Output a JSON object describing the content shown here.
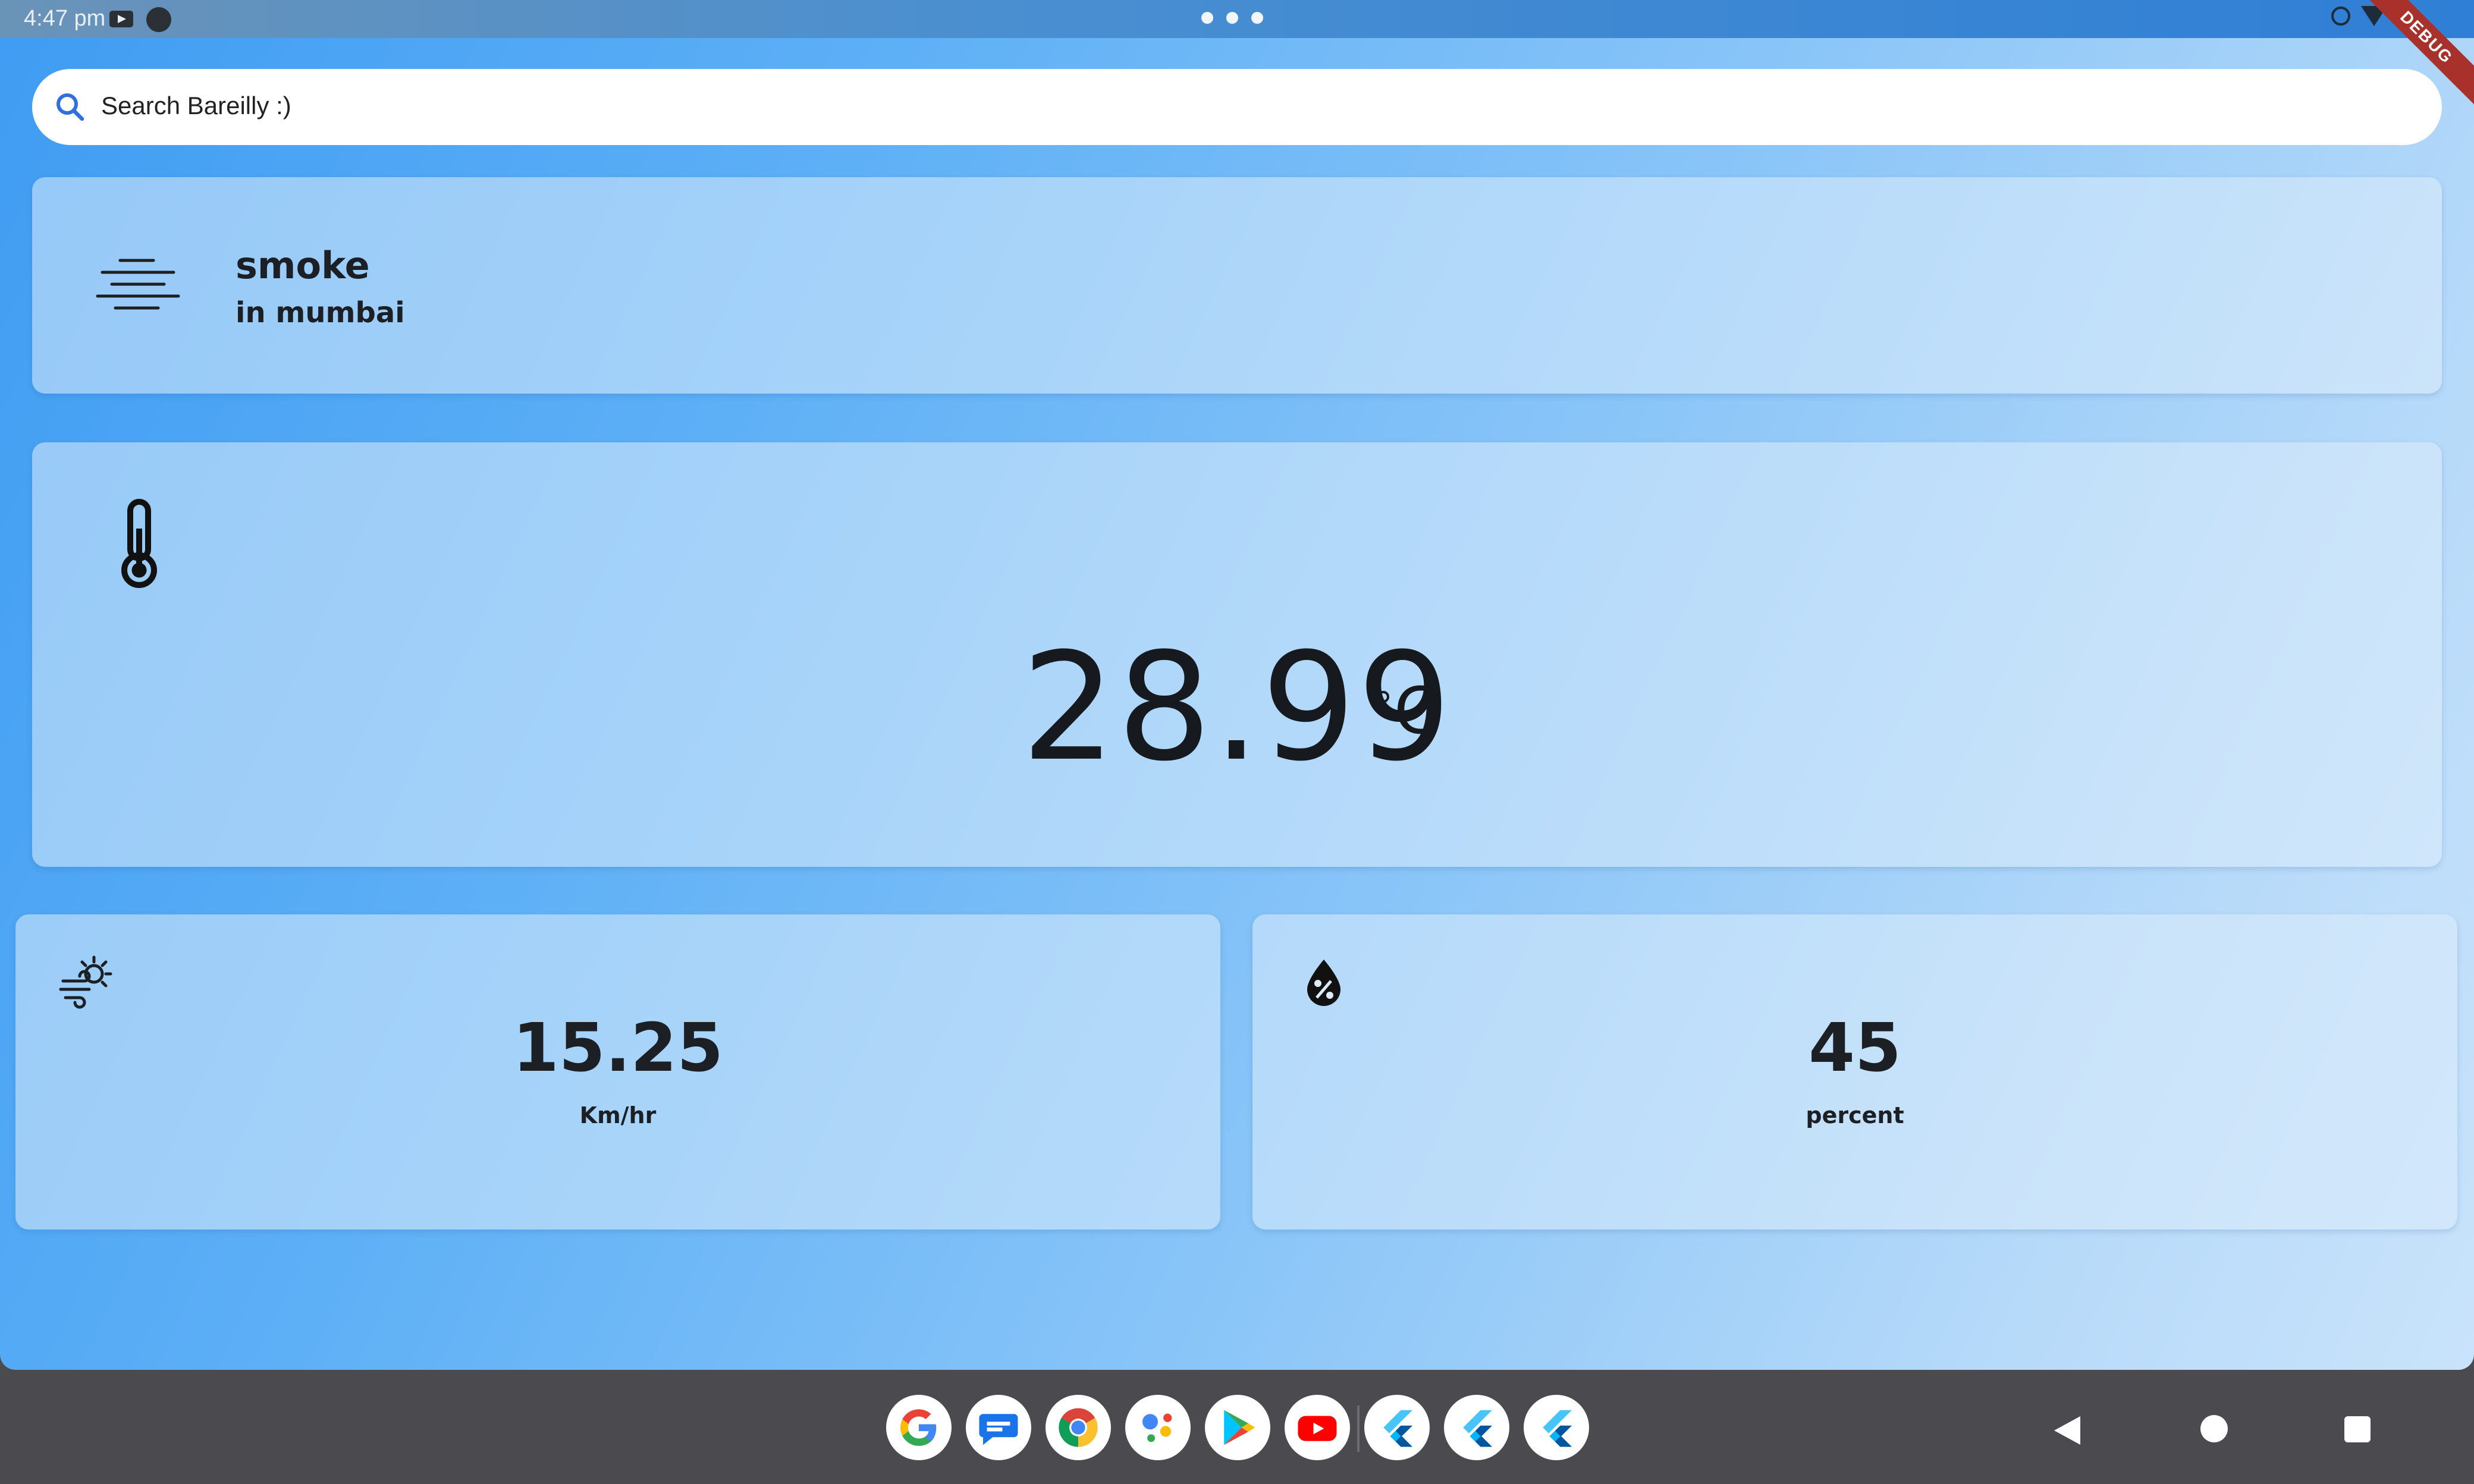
{
  "status_bar": {
    "time": "4:47 pm",
    "debug_label": "DEBUG"
  },
  "search": {
    "placeholder": "Search Bareilly :)"
  },
  "condition": {
    "title": "smoke",
    "subtitle": "in mumbai",
    "icon": "haze-lines-icon"
  },
  "temperature": {
    "value": "28.99",
    "unit": "C",
    "icon": "thermometer-icon"
  },
  "wind": {
    "value": "15.25",
    "unit": "Km/hr",
    "icon": "wind-sun-icon"
  },
  "humidity": {
    "value": "45",
    "unit": "percent",
    "icon": "humidity-percent-icon"
  },
  "taskbar": {
    "apps": [
      "google",
      "messages",
      "chrome",
      "assistant",
      "play-store",
      "youtube",
      "flutter-app-1",
      "flutter-app-2",
      "flutter-app-3"
    ]
  },
  "colors": {
    "gradient_start": "#3f9cf2",
    "gradient_end": "#c9e3fb",
    "card": "#dcecfc",
    "taskbar": "#4a4a4f",
    "debug_banner": "#a8312c"
  }
}
